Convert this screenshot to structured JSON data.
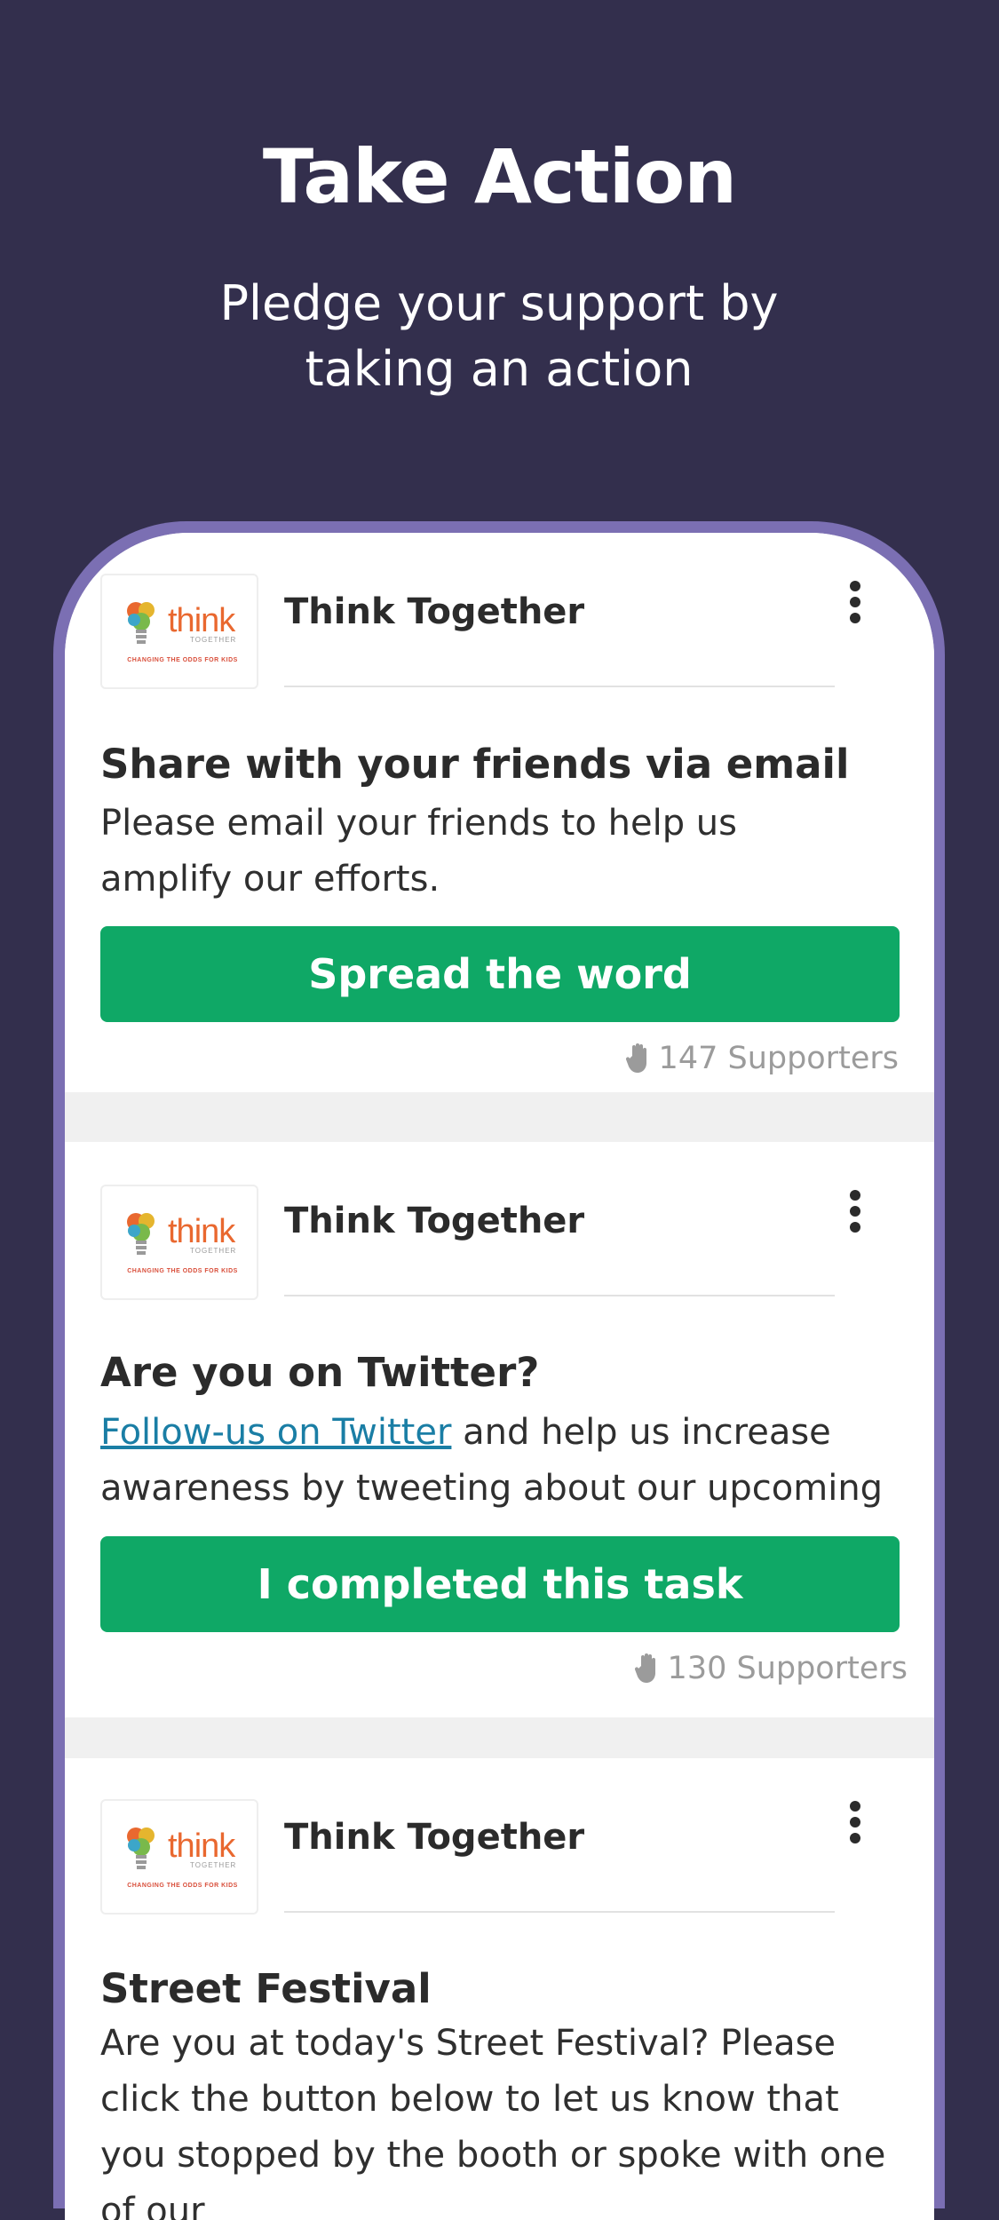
{
  "header": {
    "title": "Take Action",
    "subtitle": "Pledge your support by taking an action"
  },
  "logo": {
    "word": "think",
    "sub": "TOGETHER",
    "tagline": "CHANGING THE ODDS FOR KIDS"
  },
  "cards": [
    {
      "org": "Think Together",
      "title": "Share with your friends via email",
      "description": "Please email your friends to help us amplify our efforts.",
      "button": "Spread the word",
      "supporters": "147 Supporters"
    },
    {
      "org": "Think Together",
      "title": "Are you on Twitter?",
      "link_text": "Follow-us on Twitter",
      "description": " and help us increase awareness by tweeting about our upcoming",
      "button": "I completed this task",
      "supporters": "130 Supporters"
    },
    {
      "org": "Think Together",
      "title": "Street Festival",
      "description": "Are you at today's Street Festival? Please click the button below to let us know that you stopped by the booth or spoke with one of our"
    }
  ],
  "icons": {
    "more": "more-vertical-icon",
    "hand": "hand-icon"
  },
  "colors": {
    "background": "#332f4d",
    "phone_frame": "#7b6fb3",
    "button": "#0fa866",
    "link": "#1a7ea5",
    "logo_orange": "#e9682f"
  }
}
